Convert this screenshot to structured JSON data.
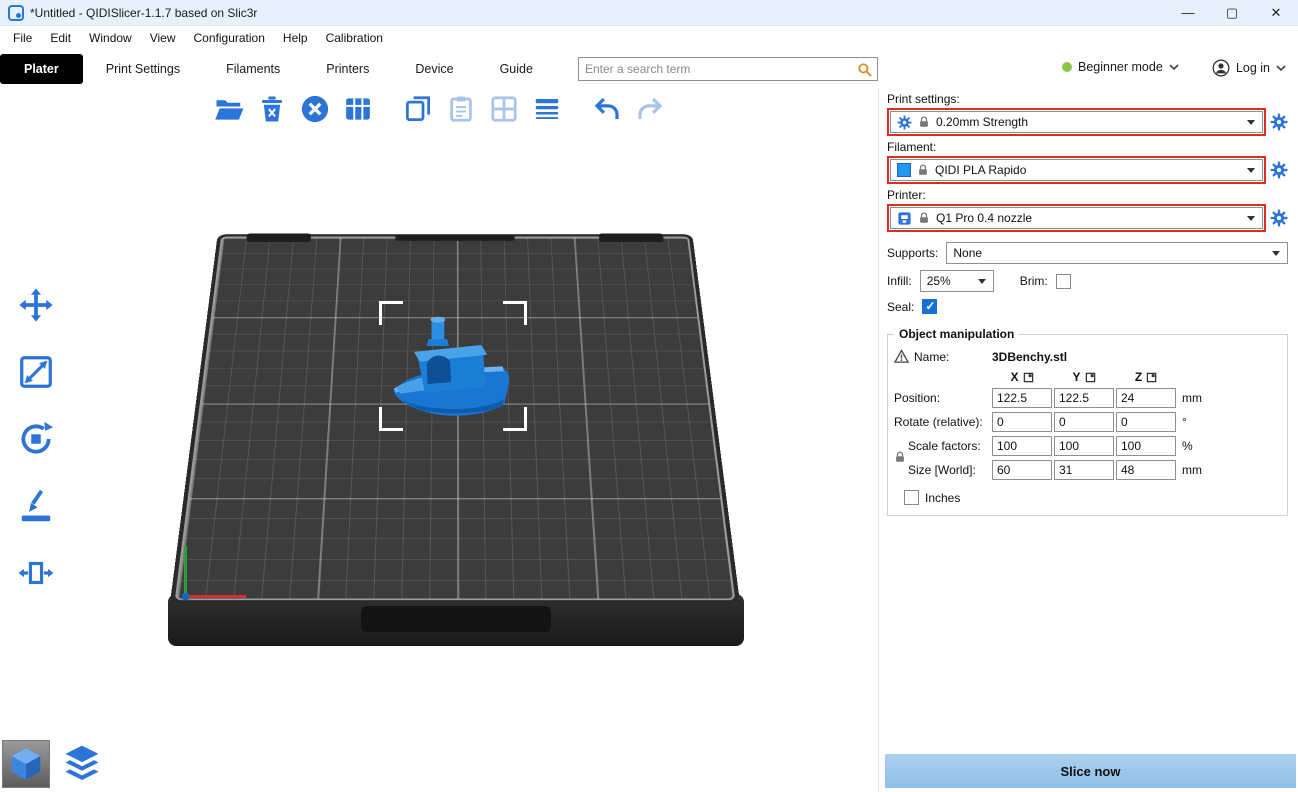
{
  "window": {
    "title": "*Untitled - QIDISlicer-1.1.7 based on Slic3r"
  },
  "menubar": {
    "items": [
      "File",
      "Edit",
      "Window",
      "View",
      "Configuration",
      "Help",
      "Calibration"
    ]
  },
  "tabs": {
    "items": [
      "Plater",
      "Print Settings",
      "Filaments",
      "Printers",
      "Device",
      "Guide"
    ],
    "active": "Plater"
  },
  "topbar": {
    "search_placeholder": "Enter a search term",
    "mode_label": "Beginner mode",
    "mode_color": "#8bc34a",
    "login_label": "Log in"
  },
  "toolbar": {
    "icons": [
      {
        "name": "open-project",
        "enabled": true
      },
      {
        "name": "delete",
        "enabled": true
      },
      {
        "name": "delete-all",
        "enabled": true
      },
      {
        "name": "arrange",
        "enabled": true
      },
      {
        "name": "copy",
        "enabled": true
      },
      {
        "name": "paste",
        "enabled": false
      },
      {
        "name": "split",
        "enabled": false
      },
      {
        "name": "variable-layer-height",
        "enabled": true
      },
      {
        "name": "undo",
        "enabled": true
      },
      {
        "name": "redo",
        "enabled": false
      }
    ]
  },
  "left_toolbar": {
    "icons": [
      "move",
      "scale",
      "rotate",
      "place-on-face",
      "mirror"
    ]
  },
  "view_toggles": {
    "icons": [
      "3d-editor-view",
      "preview-layers-view"
    ]
  },
  "scene": {
    "model": "3DBenchy",
    "model_color": "#1b79d3",
    "bed_color": "#3c3c3c",
    "selection_bracket_color": "#ffffff"
  },
  "presets": {
    "print_settings": {
      "label": "Print settings:",
      "value": "0.20mm Strength"
    },
    "filament": {
      "label": "Filament:",
      "value": "QIDI PLA Rapido"
    },
    "printer": {
      "label": "Printer:",
      "value": "Q1 Pro 0.4 nozzle"
    },
    "highlight_color": "#e02b20"
  },
  "options": {
    "supports_label": "Supports:",
    "supports_value": "None",
    "infill_label": "Infill:",
    "infill_value": "25%",
    "brim_label": "Brim:",
    "brim_checked": false,
    "seal_label": "Seal:",
    "seal_checked": true
  },
  "object_manipulation": {
    "title": "Object manipulation",
    "name_label": "Name:",
    "name_value": "3DBenchy.stl",
    "axes": [
      "X",
      "Y",
      "Z"
    ],
    "rows": [
      {
        "label": "Position:",
        "values": [
          "122.5",
          "122.5",
          "24"
        ],
        "unit": "mm",
        "lock": false
      },
      {
        "label": "Rotate (relative):",
        "values": [
          "0",
          "0",
          "0"
        ],
        "unit": "°",
        "lock": false
      },
      {
        "label": "Scale factors:",
        "values": [
          "100",
          "100",
          "100"
        ],
        "unit": "%",
        "lock": true
      },
      {
        "label": "Size [World]:",
        "values": [
          "60",
          "31",
          "48"
        ],
        "unit": "mm",
        "lock": true
      }
    ],
    "inches_label": "Inches",
    "inches_checked": false
  },
  "actions": {
    "slice_button": "Slice now"
  },
  "colors": {
    "accent_blue": "#2d74d9",
    "disabled_blue": "#a9c4e9",
    "seal_check": "#1670d6"
  }
}
